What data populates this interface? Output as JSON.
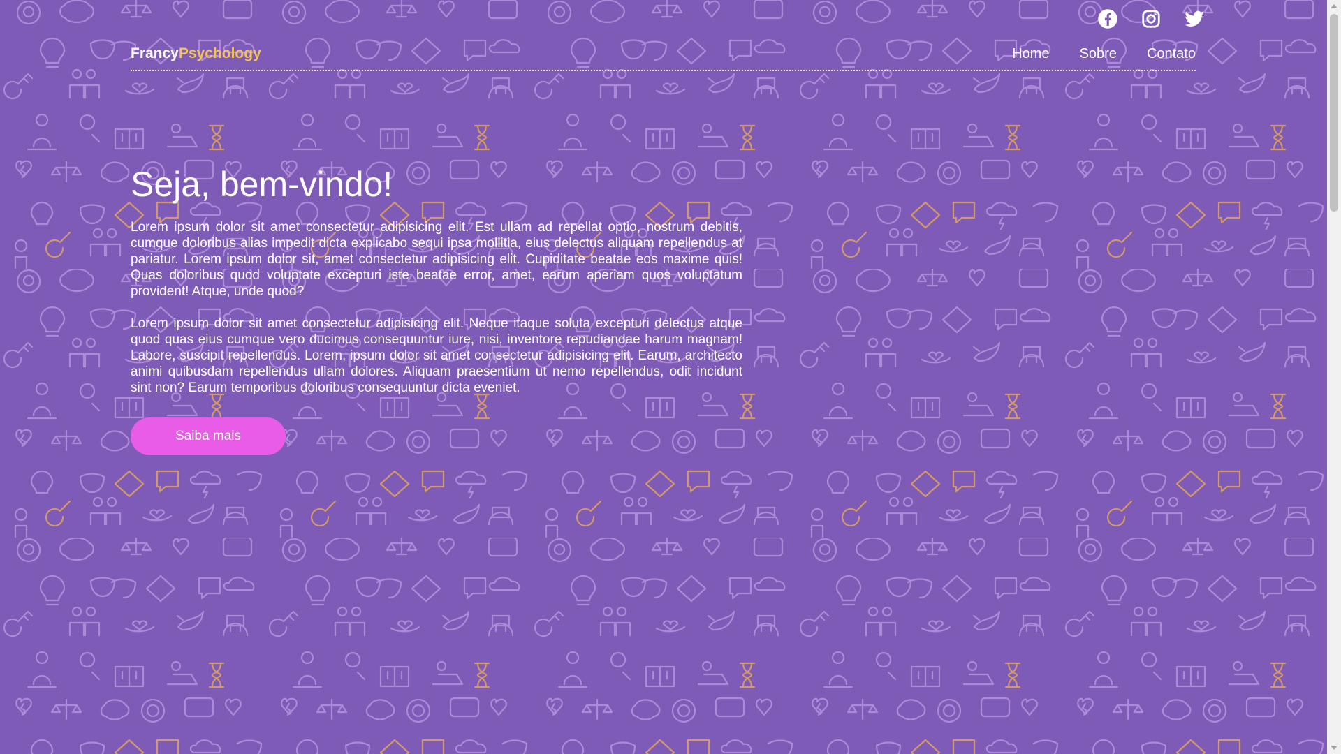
{
  "theme": {
    "background": "#7f5bb8",
    "pattern_icon": "#b592de",
    "pattern_accent": "#e0a35c",
    "logo_accent": "#f2c35d",
    "button": "#e95ce8"
  },
  "socials": [
    {
      "icon": "facebook-icon"
    },
    {
      "icon": "instagram-icon"
    },
    {
      "icon": "twitter-icon"
    }
  ],
  "header": {
    "logo_part1": "Francy",
    "logo_part2": "Psychology",
    "nav": [
      {
        "label": "Home"
      },
      {
        "label": "Sobre"
      },
      {
        "label": "Contato"
      }
    ]
  },
  "hero": {
    "title": "Seja, bem-vindo!",
    "paragraph1": "Lorem ipsum dolor sit amet consectetur adipisicing elit. Est ullam ad repellat optio, nostrum debitis, cumque doloribus alias impedit dicta explicabo sequi ipsa mollitia, eius delectus aliquam repellendus at pariatur. Lorem ipsum dolor sit, amet consectetur adipisicing elit. Cupiditate beatae eos maxime quis! Quas doloribus quod voluptate excepturi iste beatae error, amet, earum aperiam quos voluptatum provident! Atque, unde quod?",
    "paragraph2": "Lorem ipsum dolor sit amet consectetur adipisicing elit. Neque itaque soluta excepturi delectus atque quod quas eius cumque vero ducimus consequuntur iure, nisi, inventore repudiandae harum magnam! Labore, suscipit repellendus. Lorem, ipsum dolor sit amet consectetur adipisicing elit. Earum, architecto animi quibusdam repellendus ullam dolores. Aliquam praesentium ut nemo repellendus, odit incidunt sint non? Earum temporibus doloribus consequuntur dicta eveniet.",
    "cta_label": "Saiba mais"
  },
  "background_pattern_icons": [
    "sos-icon",
    "brain-icon",
    "scale-icon",
    "broken-heart-icon",
    "hourglass-icon",
    "lightbulb-icon",
    "theater-masks-icon",
    "pills-icon",
    "chat-bubbles-icon",
    "storm-cloud-icon",
    "key-icon",
    "people-icon",
    "dove-icon",
    "magnifier-icon",
    "book-icon",
    "couch-icon"
  ]
}
